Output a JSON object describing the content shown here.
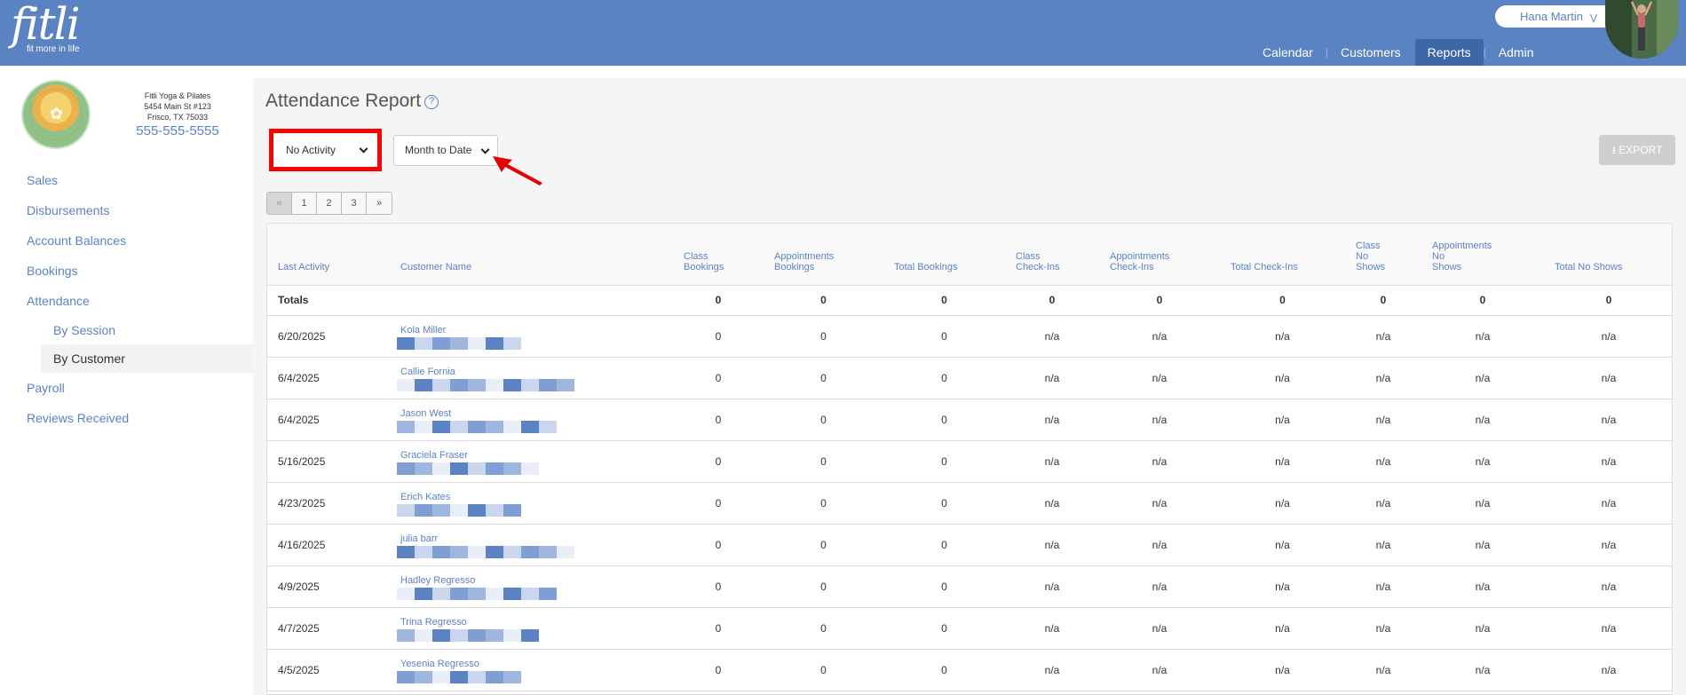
{
  "header": {
    "logo_text": "fitli",
    "logo_tagline": "fit more in life",
    "user_name": "Hana Martin",
    "nav": [
      {
        "label": "Calendar",
        "active": false
      },
      {
        "label": "Customers",
        "active": false
      },
      {
        "label": "Reports",
        "active": true
      },
      {
        "label": "Admin",
        "active": false
      }
    ]
  },
  "studio": {
    "name": "Fitli Yoga & Pilates",
    "address1": "5454 Main St #123",
    "address2": "Frisco, TX 75033",
    "phone": "555-555-5555"
  },
  "sidebar": {
    "items": [
      {
        "label": "Sales"
      },
      {
        "label": "Disbursements"
      },
      {
        "label": "Account Balances"
      },
      {
        "label": "Bookings"
      },
      {
        "label": "Attendance"
      },
      {
        "label": "By Session"
      },
      {
        "label": "By Customer"
      },
      {
        "label": "Payroll"
      },
      {
        "label": "Reviews Received"
      }
    ]
  },
  "report": {
    "title": "Attendance Report",
    "help_icon": "?",
    "activity_filter": "No Activity",
    "period_filter": "Month to Date",
    "export_label": "EXPORT",
    "pager": [
      "«",
      "1",
      "2",
      "3",
      "»"
    ]
  },
  "table": {
    "headers": {
      "last_activity": "Last Activity",
      "customer_name": "Customer Name",
      "class_bookings": [
        "Class",
        "Bookings"
      ],
      "appointments_bookings": [
        "Appointments",
        "Bookings"
      ],
      "total_bookings": "Total Bookings",
      "class_checkins": [
        "Class",
        "Check-Ins"
      ],
      "appointments_checkins": [
        "Appointments",
        "Check-Ins"
      ],
      "total_checkins": "Total Check-Ins",
      "class_noshows": [
        "Class",
        "No",
        "Shows"
      ],
      "appointments_noshows": [
        "Appointments",
        "No",
        "Shows"
      ],
      "total_noshows": "Total No Shows"
    },
    "totals": {
      "label": "Totals",
      "values": [
        "0",
        "0",
        "0",
        "0",
        "0",
        "0",
        "0",
        "0",
        "0"
      ]
    },
    "rows": [
      {
        "date": "6/20/2025",
        "name": "Kola Miller",
        "values": [
          "0",
          "0",
          "0",
          "n/a",
          "n/a",
          "n/a",
          "n/a",
          "n/a",
          "n/a"
        ]
      },
      {
        "date": "6/4/2025",
        "name": "Callie Fornia",
        "values": [
          "0",
          "0",
          "0",
          "n/a",
          "n/a",
          "n/a",
          "n/a",
          "n/a",
          "n/a"
        ]
      },
      {
        "date": "6/4/2025",
        "name": "Jason West",
        "values": [
          "0",
          "0",
          "0",
          "n/a",
          "n/a",
          "n/a",
          "n/a",
          "n/a",
          "n/a"
        ]
      },
      {
        "date": "5/16/2025",
        "name": "Graciela Fraser",
        "values": [
          "0",
          "0",
          "0",
          "n/a",
          "n/a",
          "n/a",
          "n/a",
          "n/a",
          "n/a"
        ]
      },
      {
        "date": "4/23/2025",
        "name": "Erich Kates",
        "values": [
          "0",
          "0",
          "0",
          "n/a",
          "n/a",
          "n/a",
          "n/a",
          "n/a",
          "n/a"
        ]
      },
      {
        "date": "4/16/2025",
        "name": "julia barr",
        "values": [
          "0",
          "0",
          "0",
          "n/a",
          "n/a",
          "n/a",
          "n/a",
          "n/a",
          "n/a"
        ]
      },
      {
        "date": "4/9/2025",
        "name": "Hadley Regresso",
        "values": [
          "0",
          "0",
          "0",
          "n/a",
          "n/a",
          "n/a",
          "n/a",
          "n/a",
          "n/a"
        ]
      },
      {
        "date": "4/7/2025",
        "name": "Trina Regresso",
        "values": [
          "0",
          "0",
          "0",
          "n/a",
          "n/a",
          "n/a",
          "n/a",
          "n/a",
          "n/a"
        ]
      },
      {
        "date": "4/5/2025",
        "name": "Yesenia Regresso",
        "values": [
          "0",
          "0",
          "0",
          "n/a",
          "n/a",
          "n/a",
          "n/a",
          "n/a",
          "n/a"
        ]
      }
    ]
  },
  "colors": {
    "brand": "#5b82c3",
    "nav_active": "#3e67a8",
    "highlight": "#ff0000"
  }
}
